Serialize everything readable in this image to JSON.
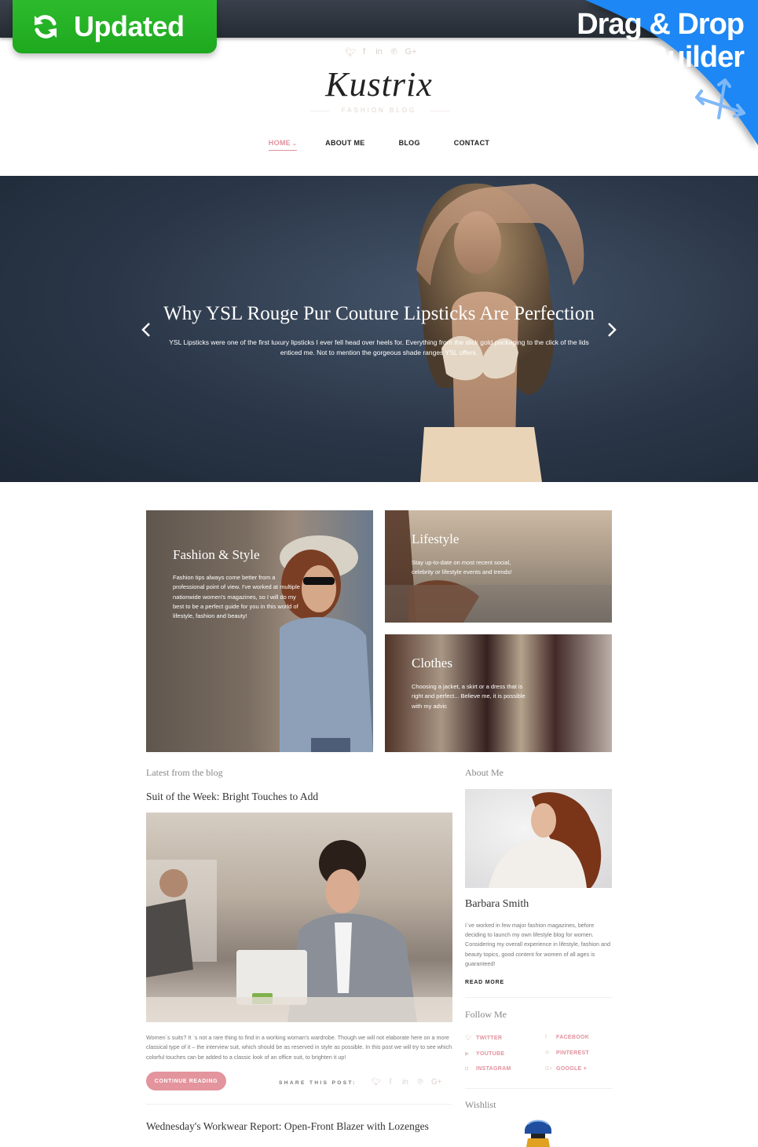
{
  "promo": {
    "updated_label": "Updated",
    "updated_icon": "sync-icon",
    "dd_line1": "Drag & Drop",
    "dd_line2": "Builder",
    "dd_icon": "move-arrows-icon",
    "colors": {
      "green": "#22b022",
      "blue": "#1a87f5"
    }
  },
  "header": {
    "social_icons": [
      {
        "name": "twitter-icon",
        "glyph": "🐦︎"
      },
      {
        "name": "facebook-icon",
        "glyph": "f"
      },
      {
        "name": "linkedin-icon",
        "glyph": "in"
      },
      {
        "name": "pinterest-icon",
        "glyph": "℗"
      },
      {
        "name": "google-plus-icon",
        "glyph": "G+"
      }
    ],
    "logo": "Kustrix",
    "tagline": "FASHION BLOG"
  },
  "nav": {
    "items": [
      {
        "label": "HOME",
        "active": true
      },
      {
        "label": "ABOUT ME",
        "active": false
      },
      {
        "label": "BLOG",
        "active": false
      },
      {
        "label": "CONTACT",
        "active": false
      }
    ],
    "dropdown_glyph": "⌄"
  },
  "hero": {
    "title": "Why YSL Rouge Pur Couture Lipsticks Are Perfection",
    "text": "YSL Lipsticks were one of the first luxury lipsticks I ever fell head over heels for. Everything from the slick gold packaging to the click of the lids enticed me. Not to mention the gorgeous shade ranges YSL offers."
  },
  "categories": [
    {
      "title": "Fashion & Style",
      "text": "Fashion tips always come better from a professional point of view. I've worked at multiple nationwide women's magazines, so I will do my best to be a perfect guide for you in this world of lifestyle, fashion and beauty!"
    },
    {
      "title": "Lifestyle",
      "text": "Stay up-to-date on most recent social, celebrity or lifestyle events and trends!"
    },
    {
      "title": "Clothes",
      "text": "Choosing a jacket, a skirt or a dress that is right and perfect... Believe me, it is possible with my advic"
    }
  ],
  "blog": {
    "section_label": "Latest from the blog",
    "posts": [
      {
        "title": "Suit of the Week: Bright Touches to Add",
        "excerpt": "Women`s suits? It `s not a rare thing to find in a working woman's wardrobe. Though we will not elaborate here on a more classical type of it – the interview suit, which should be as reserved in style as possible. In this post we will try to see which colorful touches can be added to a classic look of an office suit, to brighten it up!",
        "button": "CONTINUE READING",
        "share_label": "SHARE THIS POST:"
      },
      {
        "title": "Wednesday's Workwear Report: Open-Front Blazer with Lozenges"
      }
    ],
    "share_icons": [
      "twitter-icon",
      "facebook-icon",
      "linkedin-icon",
      "pinterest-icon",
      "google-plus-icon"
    ]
  },
  "sidebar": {
    "about_label": "About Me",
    "author_name": "Barbara Smith",
    "author_bio": "I`ve worked in few major fashion magazines, before deciding to launch my own lifestyle blog for women. Considering my overall experience in lifestyle, fashion and beauty topics, good content for women of all ages is guaranteed!",
    "read_more": "READ MORE",
    "follow_label": "Follow Me",
    "follow_links": [
      {
        "label": "TWITTER",
        "icon": "twitter-icon",
        "glyph": "🐦︎"
      },
      {
        "label": "FACEBOOK",
        "icon": "facebook-icon",
        "glyph": "f"
      },
      {
        "label": "YOUTUBE",
        "icon": "youtube-icon",
        "glyph": "▶"
      },
      {
        "label": "PINTEREST",
        "icon": "pinterest-icon",
        "glyph": "℗"
      },
      {
        "label": "INSTAGRAM",
        "icon": "instagram-icon",
        "glyph": "◘"
      },
      {
        "label": "GOOGLE +",
        "icon": "google-plus-icon",
        "glyph": "G+"
      }
    ],
    "wishlist_label": "Wishlist"
  },
  "colors": {
    "accent_pink": "#e3949c",
    "hero_bg": "#2a3647"
  }
}
